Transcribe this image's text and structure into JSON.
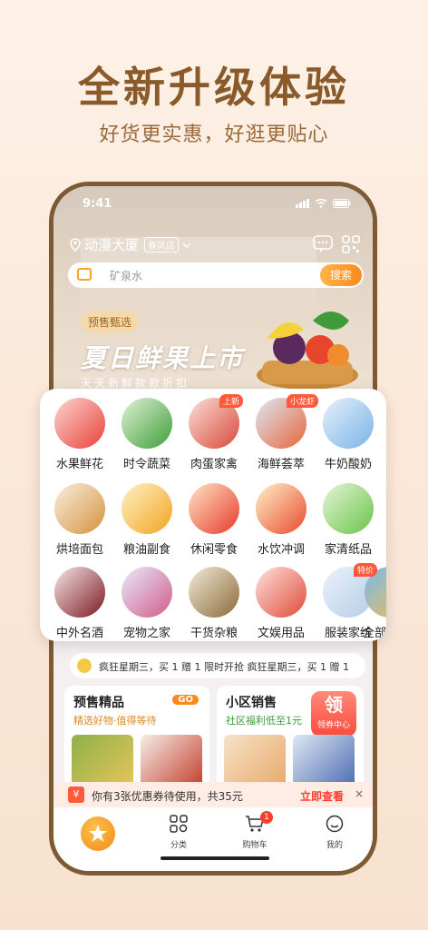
{
  "promo": {
    "title": "全新升级体验",
    "subtitle": "好货更实惠，好逛更贴心"
  },
  "status_bar": {
    "time": "9:41"
  },
  "location": {
    "name": "动漫大厦",
    "store": "春风店"
  },
  "search": {
    "placeholder": "矿泉水",
    "button": "搜索"
  },
  "banner": {
    "badge": "预售甄选",
    "title": "夏日鲜果上市",
    "subtitle": "天天新鲜款款折扣"
  },
  "categories": [
    {
      "label": "水果鲜花",
      "tag": ""
    },
    {
      "label": "时令蔬菜",
      "tag": ""
    },
    {
      "label": "肉蛋家禽",
      "tag": "上新"
    },
    {
      "label": "海鲜荟萃",
      "tag": "小龙虾"
    },
    {
      "label": "牛奶酸奶",
      "tag": ""
    },
    {
      "label": "烘培面包",
      "tag": ""
    },
    {
      "label": "粮油副食",
      "tag": ""
    },
    {
      "label": "休闲零食",
      "tag": ""
    },
    {
      "label": "水饮冲调",
      "tag": ""
    },
    {
      "label": "家清纸品",
      "tag": ""
    },
    {
      "label": "中外名酒",
      "tag": ""
    },
    {
      "label": "宠物之家",
      "tag": ""
    },
    {
      "label": "干货杂粮",
      "tag": ""
    },
    {
      "label": "文娱用品",
      "tag": ""
    },
    {
      "label": "服装家纺",
      "tag": "特价"
    },
    {
      "label": "全部",
      "tag": ""
    }
  ],
  "notice": {
    "text": "疯狂星期三，买 1 赠 1 限时开抢     疯狂星期三，买 1 赠 1"
  },
  "cards": {
    "presale": {
      "title": "预售精品",
      "subtitle": "精选好物·值得等待",
      "go": "GO"
    },
    "community": {
      "title": "小区销售",
      "subtitle": "社区福利低至1元",
      "badge": "领",
      "badge_sub": "领券中心"
    }
  },
  "coupon": {
    "icon": "¥",
    "text": "你有3张优惠券待使用，共35元",
    "link": "立即查看",
    "close": "×"
  },
  "tabbar": {
    "tabs": [
      {
        "label": "分类"
      },
      {
        "label": "购物车",
        "badge": "1"
      },
      {
        "label": "我的"
      }
    ]
  },
  "colors": {
    "accent": "#ff8a1c",
    "brand_brown": "#8a5a2b",
    "badge_red": "#ff3c2a"
  }
}
